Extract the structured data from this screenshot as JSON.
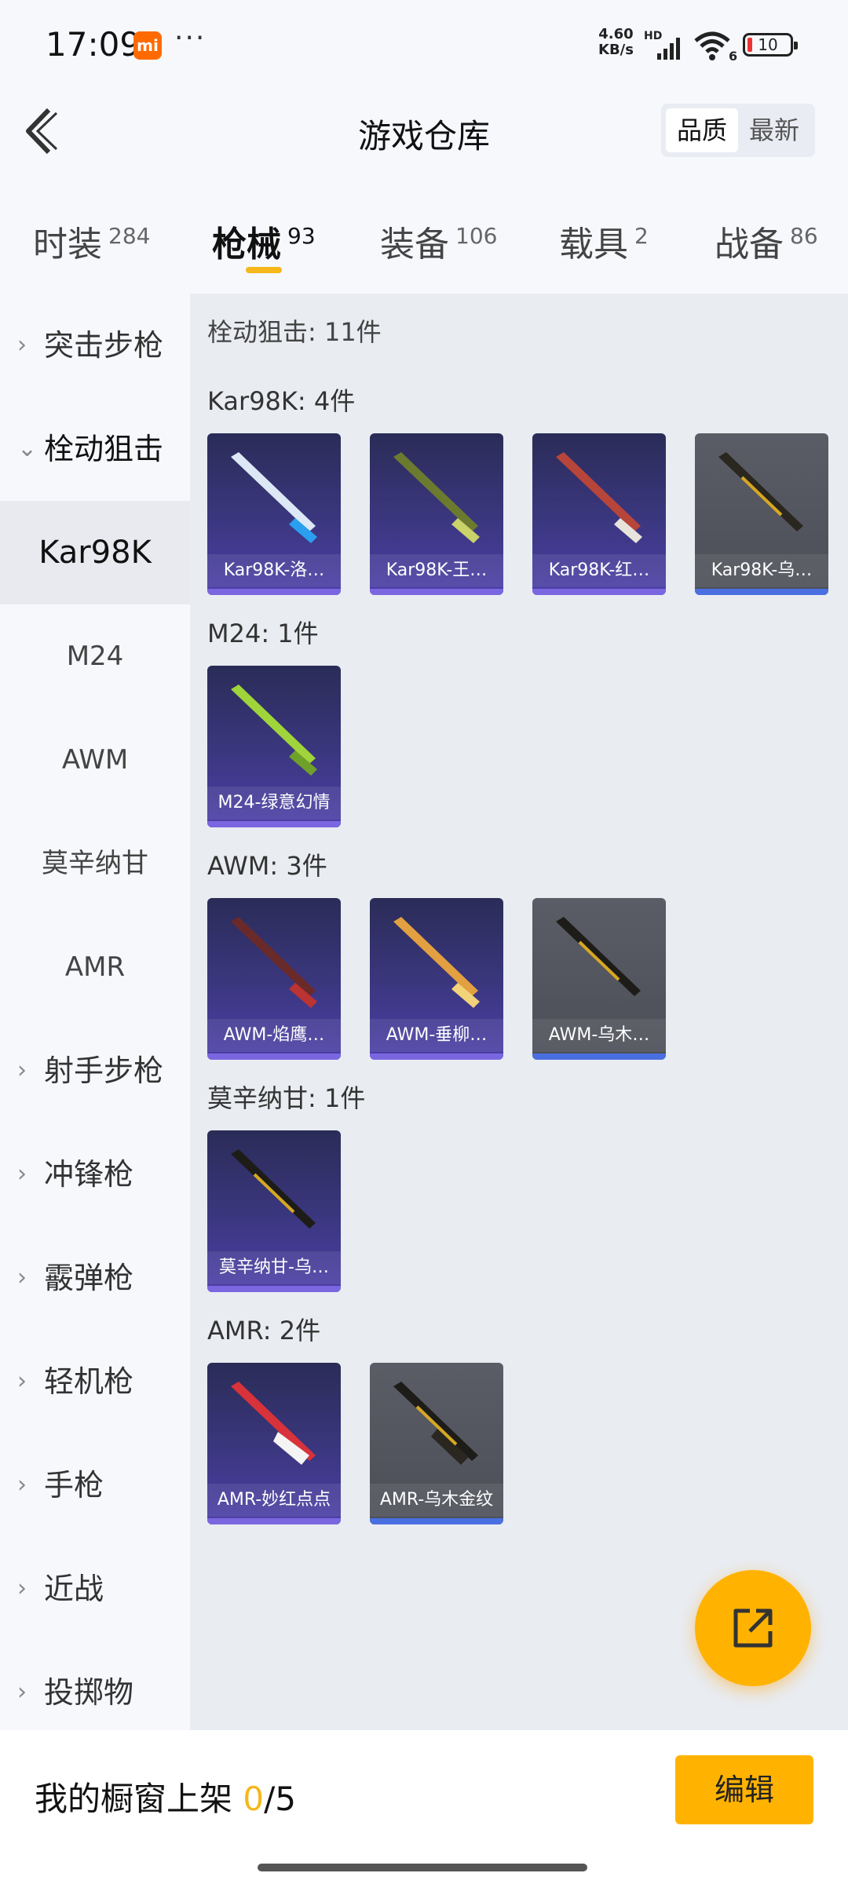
{
  "status": {
    "time": "17:09",
    "mi_logo": "mi",
    "dots": "···",
    "net_speed_value": "4.60",
    "net_speed_unit": "KB/s",
    "hd": "HD",
    "wifi_badge": "6",
    "battery": "10"
  },
  "header": {
    "title": "游戏仓库",
    "sort_quality": "品质",
    "sort_newest": "最新"
  },
  "tabs": [
    {
      "label": "时装",
      "count": "284"
    },
    {
      "label": "枪械",
      "count": "93"
    },
    {
      "label": "装备",
      "count": "106"
    },
    {
      "label": "载具",
      "count": "2"
    },
    {
      "label": "战备",
      "count": "86"
    }
  ],
  "sidebar": [
    {
      "label": "突击步枪",
      "chev": "›"
    },
    {
      "label": "栓动狙击",
      "chev": "⌄"
    },
    {
      "label": "Kar98K"
    },
    {
      "label": "M24"
    },
    {
      "label": "AWM"
    },
    {
      "label": "莫辛纳甘"
    },
    {
      "label": "AMR"
    },
    {
      "label": "射手步枪",
      "chev": "›"
    },
    {
      "label": "冲锋枪",
      "chev": "›"
    },
    {
      "label": "霰弹枪",
      "chev": "›"
    },
    {
      "label": "轻机枪",
      "chev": "›"
    },
    {
      "label": "手枪",
      "chev": "›"
    },
    {
      "label": "近战",
      "chev": "›"
    },
    {
      "label": "投掷物",
      "chev": "›"
    }
  ],
  "content": {
    "summary": "栓动狙击: 11件",
    "groups": [
      {
        "title": "Kar98K: 4件",
        "items": [
          "Kar98K-洛…",
          "Kar98K-王…",
          "Kar98K-红…",
          "Kar98K-乌…"
        ]
      },
      {
        "title": "M24: 1件",
        "items": [
          "M24-绿意幻情"
        ]
      },
      {
        "title": "AWM: 3件",
        "items": [
          "AWM-焰鹰…",
          "AWM-垂柳…",
          "AWM-乌木…"
        ]
      },
      {
        "title": "莫辛纳甘: 1件",
        "items": [
          "莫辛纳甘-乌…"
        ]
      },
      {
        "title": "AMR: 2件",
        "items": [
          "AMR-妙红点点",
          "AMR-乌木金纹"
        ]
      }
    ]
  },
  "bottom": {
    "showcase_label": "我的橱窗上架",
    "showcase_current": "0",
    "showcase_total": "/5",
    "edit": "编辑"
  },
  "colors": {
    "accent": "#ffb300",
    "tab_indicator": "#f5b71a",
    "card_purple": "#3b3780",
    "card_gray": "#54565f"
  },
  "icons": [
    "back-arrow-icon",
    "share-external-icon",
    "chevron-right-icon",
    "chevron-down-icon",
    "signal-icon",
    "wifi-icon",
    "battery-icon"
  ]
}
